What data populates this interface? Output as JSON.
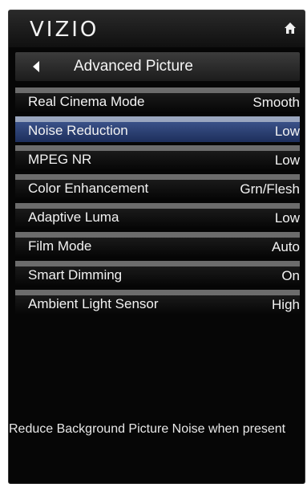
{
  "header": {
    "brand": "VIZIO",
    "home_icon": "home-icon"
  },
  "title_bar": {
    "back_icon": "back-arrow-icon",
    "title": "Advanced Picture"
  },
  "menu": {
    "items": [
      {
        "label": "Real Cinema Mode",
        "value": "Smooth"
      },
      {
        "label": "Noise Reduction",
        "value": "Low"
      },
      {
        "label": "MPEG NR",
        "value": "Low"
      },
      {
        "label": "Color Enhancement",
        "value": "Grn/Flesh"
      },
      {
        "label": "Adaptive Luma",
        "value": "Low"
      },
      {
        "label": "Film Mode",
        "value": "Auto"
      },
      {
        "label": "Smart Dimming",
        "value": "On"
      },
      {
        "label": "Ambient Light Sensor",
        "value": "High"
      }
    ],
    "selected_index": 1
  },
  "help": {
    "text": "Reduce Background Picture Noise when present"
  },
  "colors": {
    "background": "#060606",
    "selected_highlight": "#3a5188",
    "separator": "#6c6c6c",
    "text": "#f2f2f2"
  }
}
